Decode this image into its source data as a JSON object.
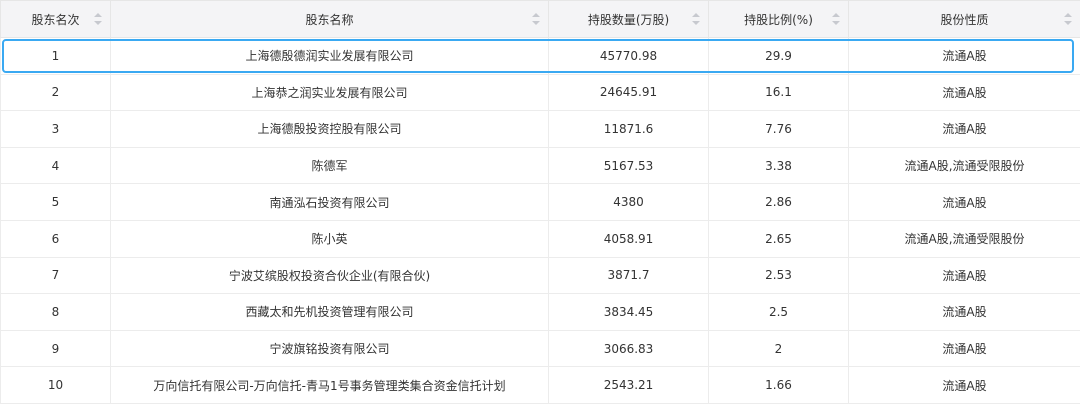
{
  "table": {
    "headers": [
      "股东名次",
      "股东名称",
      "持股数量(万股)",
      "持股比例(%)",
      "股份性质"
    ],
    "rows": [
      [
        "1",
        "上海德殷德润实业发展有限公司",
        "45770.98",
        "29.9",
        "流通A股"
      ],
      [
        "2",
        "上海恭之润实业发展有限公司",
        "24645.91",
        "16.1",
        "流通A股"
      ],
      [
        "3",
        "上海德殷投资控股有限公司",
        "11871.6",
        "7.76",
        "流通A股"
      ],
      [
        "4",
        "陈德军",
        "5167.53",
        "3.38",
        "流通A股,流通受限股份"
      ],
      [
        "5",
        "南通泓石投资有限公司",
        "4380",
        "2.86",
        "流通A股"
      ],
      [
        "6",
        "陈小英",
        "4058.91",
        "2.65",
        "流通A股,流通受限股份"
      ],
      [
        "7",
        "宁波艾缤股权投资合伙企业(有限合伙)",
        "3871.7",
        "2.53",
        "流通A股"
      ],
      [
        "8",
        "西藏太和先机投资管理有限公司",
        "3834.45",
        "2.5",
        "流通A股"
      ],
      [
        "9",
        "宁波旗铭投资有限公司",
        "3066.83",
        "2",
        "流通A股"
      ],
      [
        "10",
        "万向信托有限公司-万向信托-青马1号事务管理类集合资金信托计划",
        "2543.21",
        "1.66",
        "流通A股"
      ]
    ],
    "selected_row": "1",
    "accent_color": "#3aa9f2"
  }
}
